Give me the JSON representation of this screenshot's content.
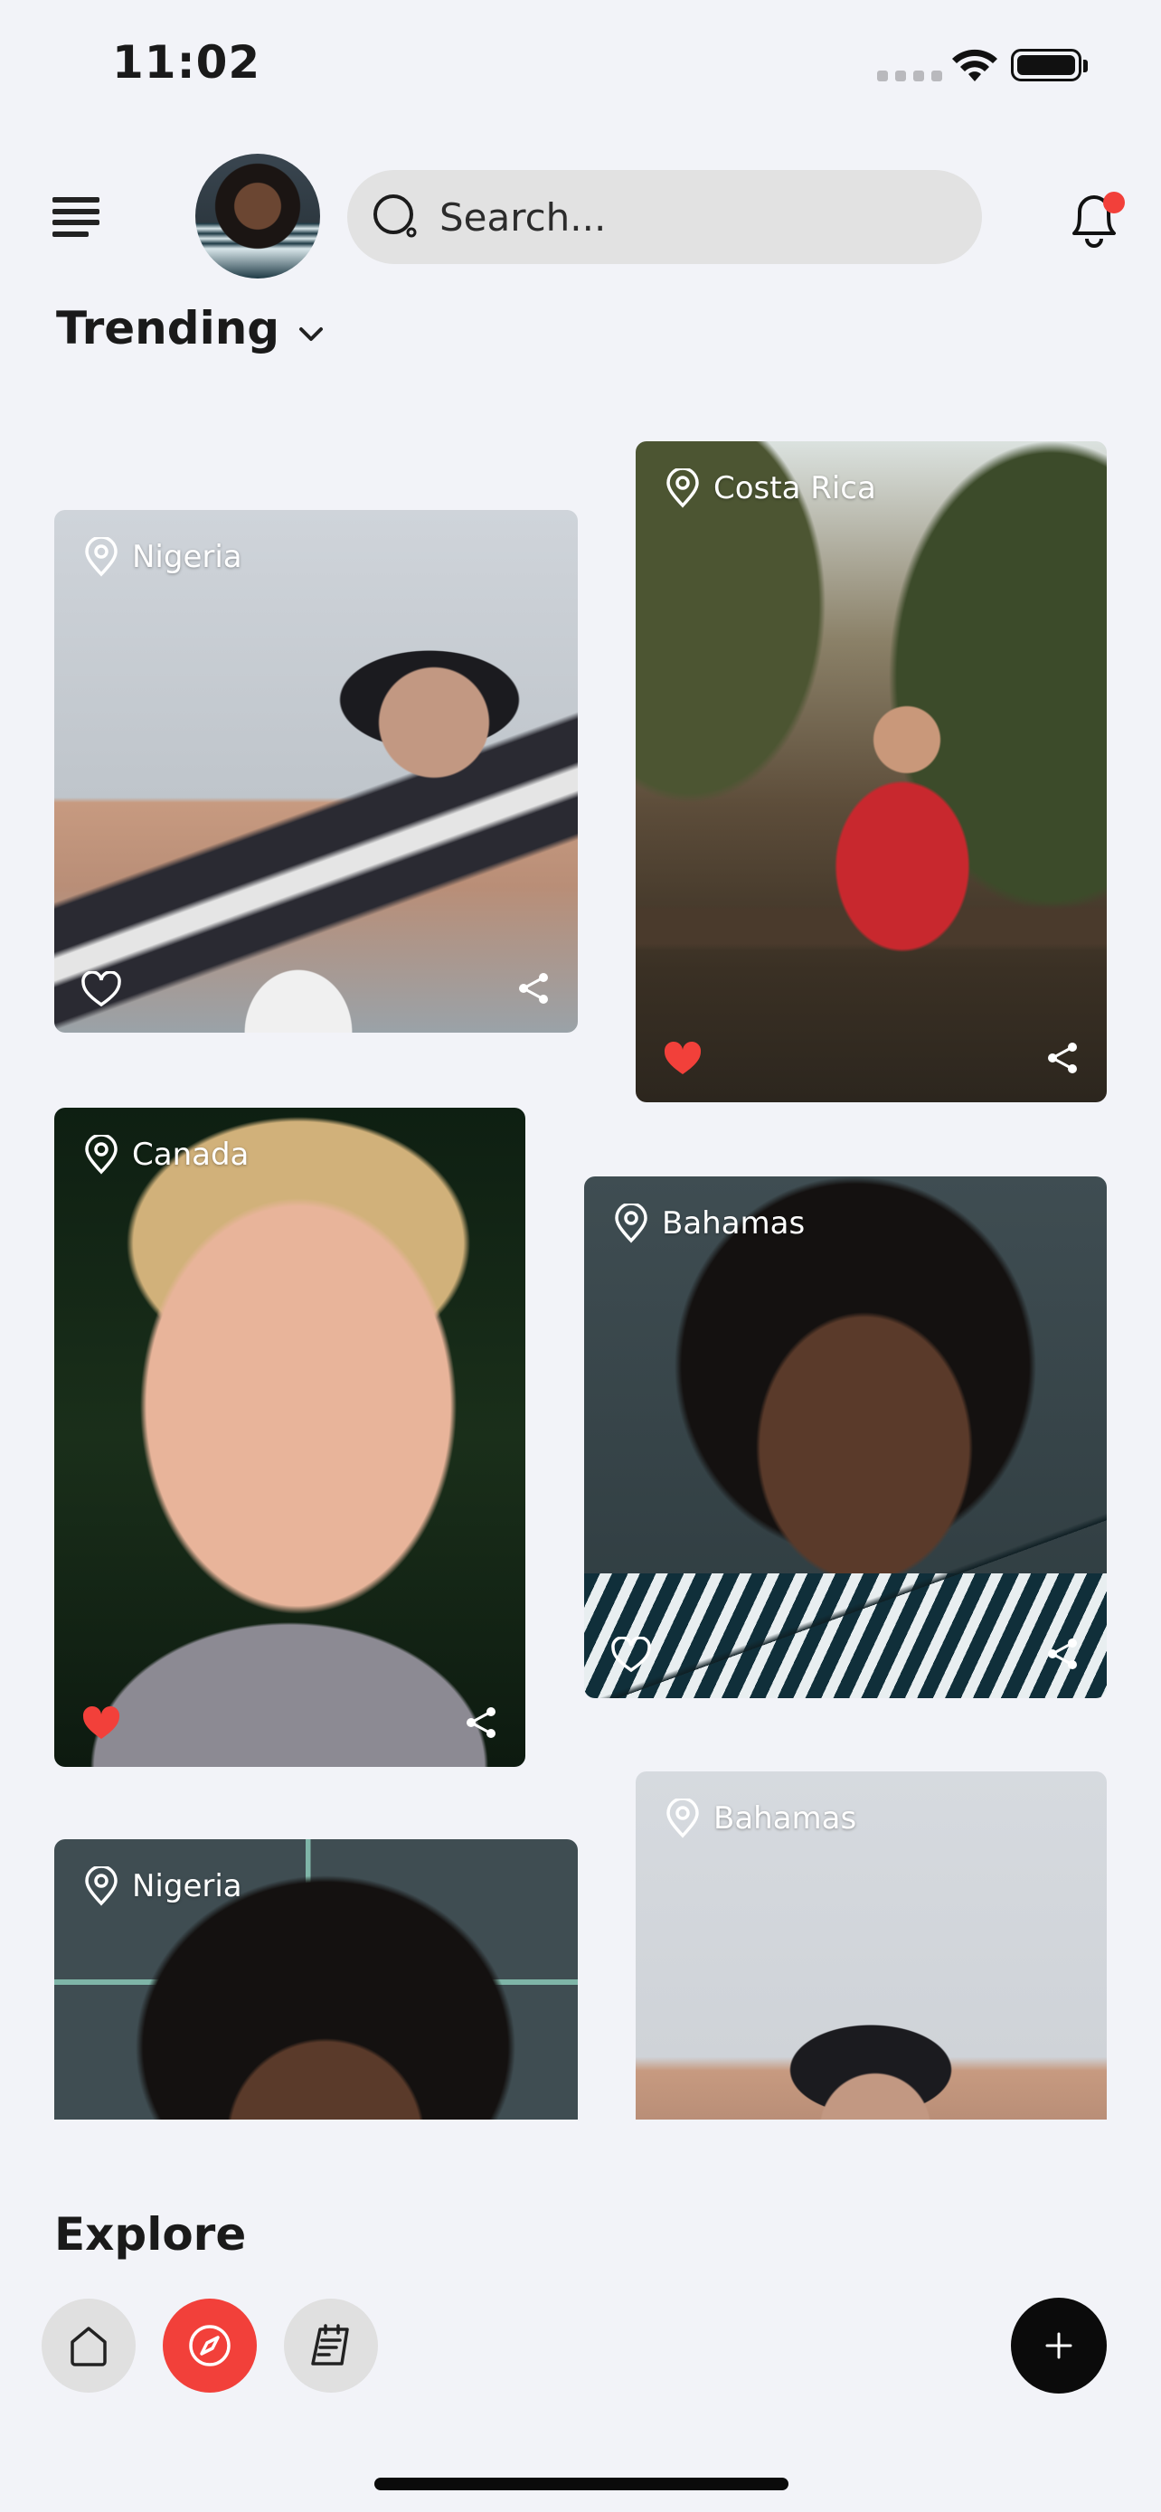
{
  "status_bar": {
    "time": "11:02"
  },
  "header": {
    "search_placeholder": "Search...",
    "notification_badge_color": "#f2403a"
  },
  "section": {
    "title": "Trending"
  },
  "cards": [
    {
      "location": "Nigeria",
      "liked": false
    },
    {
      "location": "Costa Rica",
      "liked": true
    },
    {
      "location": "Canada",
      "liked": true
    },
    {
      "location": "Bahamas",
      "liked": false
    },
    {
      "location": "Nigeria",
      "liked": false
    },
    {
      "location": "Bahamas",
      "liked": false
    }
  ],
  "footer": {
    "title": "Explore",
    "accent_color": "#f2403a"
  },
  "icons": [
    "menu-icon",
    "search-icon",
    "bell-icon",
    "chevron-down-icon",
    "location-pin-icon",
    "heart-icon",
    "share-icon",
    "home-icon",
    "compass-icon",
    "notes-icon",
    "plus-icon"
  ]
}
